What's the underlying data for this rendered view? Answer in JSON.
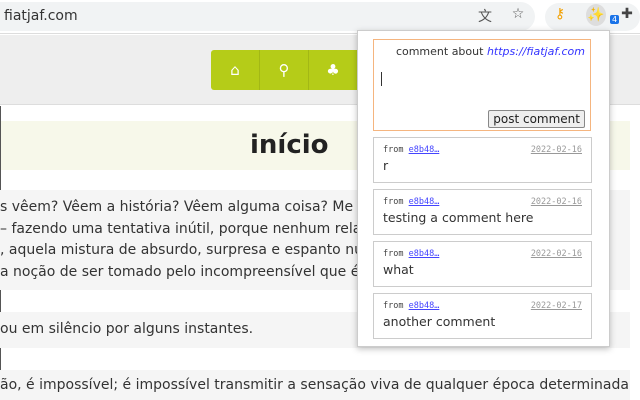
{
  "browser": {
    "url": "fiatjaf.com",
    "icons": [
      "translate-icon",
      "star-icon",
      "keys-extension-icon",
      "magic-wand-extension-icon",
      "puzzle-extensions-icon"
    ],
    "extension_badge": "4"
  },
  "site": {
    "nav": [
      "home-icon",
      "search-icon",
      "tree-icon"
    ],
    "accent": "#b5cc18",
    "title": "início",
    "paragraphs": [
      [
        "s vêem? Vêem a história? Vêem alguma coisa? Me parece",
        "– fazendo uma tentativa inútil, porque nenhum relato d",
        ", aquela mistura de absurdo, surpresa e espanto numa e",
        "a noção de ser tomado pelo incompreensível que é da p"
      ],
      [
        "ou em silêncio por alguns instantes."
      ],
      [
        "ão, é impossível; é impossível transmitir a sensação viva de qualquer época determinada de"
      ]
    ]
  },
  "popup": {
    "comment_about": "comment about",
    "link": "https://fiatjaf.com",
    "textarea_value": "",
    "post_button": "post comment",
    "comments": [
      {
        "from_label": "from",
        "author": "e8b48…",
        "date": "2022-02-16",
        "text": "r"
      },
      {
        "from_label": "from",
        "author": "e8b48…",
        "date": "2022-02-16",
        "text": "testing a comment here"
      },
      {
        "from_label": "from",
        "author": "e8b48…",
        "date": "2022-02-16",
        "text": "what"
      },
      {
        "from_label": "from",
        "author": "e8b48…",
        "date": "2022-02-17",
        "text": "another comment"
      }
    ]
  }
}
